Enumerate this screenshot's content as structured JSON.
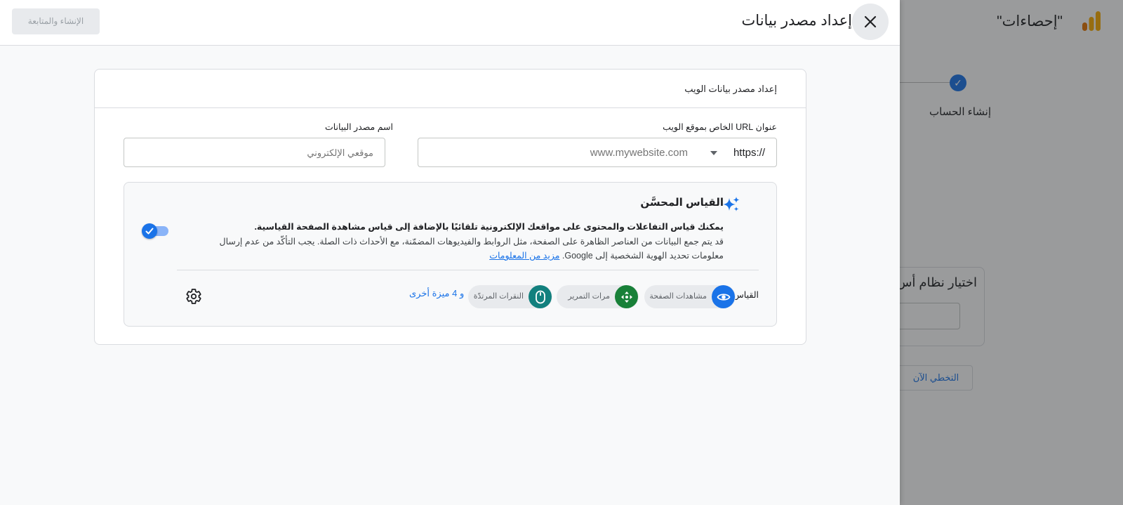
{
  "background": {
    "app_title": "\"إحصاءات\"",
    "step_label": "إنشاء الحساب",
    "card_title": "اختيار نظام أس",
    "skip_label": "التخطي الآن"
  },
  "panel": {
    "title": "إعداد مصدر بيانات",
    "continue_label": "الإنشاء والمتابعة",
    "card_title": "إعداد مصدر بيانات الويب",
    "url_label": "عنوان URL الخاص بموقع الويب",
    "protocol_value": "https://",
    "url_placeholder": "www.mywebsite.com",
    "name_label": "اسم مصدر البيانات",
    "name_placeholder": "موقعي الإلكتروني",
    "enhanced": {
      "title": "القياس المحسَّن",
      "desc_bold": "يمكنك قياس التفاعلات والمحتوى على مواقعك الإلكترونية تلقائيًا بالإضافة إلى قياس مشاهدة الصفحة القياسية.",
      "desc_text": "قد يتم جمع البيانات من العناصر الظاهرة على الصفحة، مثل الروابط والفيديوهات المضمّنة، مع الأحداث ذات الصلة. يجب التأكّد من عدم إرسال معلومات تحديد الهوية الشخصية إلى Google.",
      "learn_more": "مزيد من المعلومات",
      "toggle_on": true,
      "measures_label": "القياس:",
      "chips": [
        {
          "label": "مشاهدات الصفحة",
          "icon": "eye-icon",
          "color": "#1a73e8"
        },
        {
          "label": "مرات التمرير",
          "icon": "scroll-arrows-icon",
          "color": "#188038"
        },
        {
          "label": "النقرات المرتدّة",
          "icon": "mouse-icon",
          "color": "#12807e"
        }
      ],
      "more_label": "و 4 ميزة أخرى"
    }
  },
  "colors": {
    "accent": "#1a73e8",
    "green": "#188038",
    "teal": "#12807e"
  }
}
